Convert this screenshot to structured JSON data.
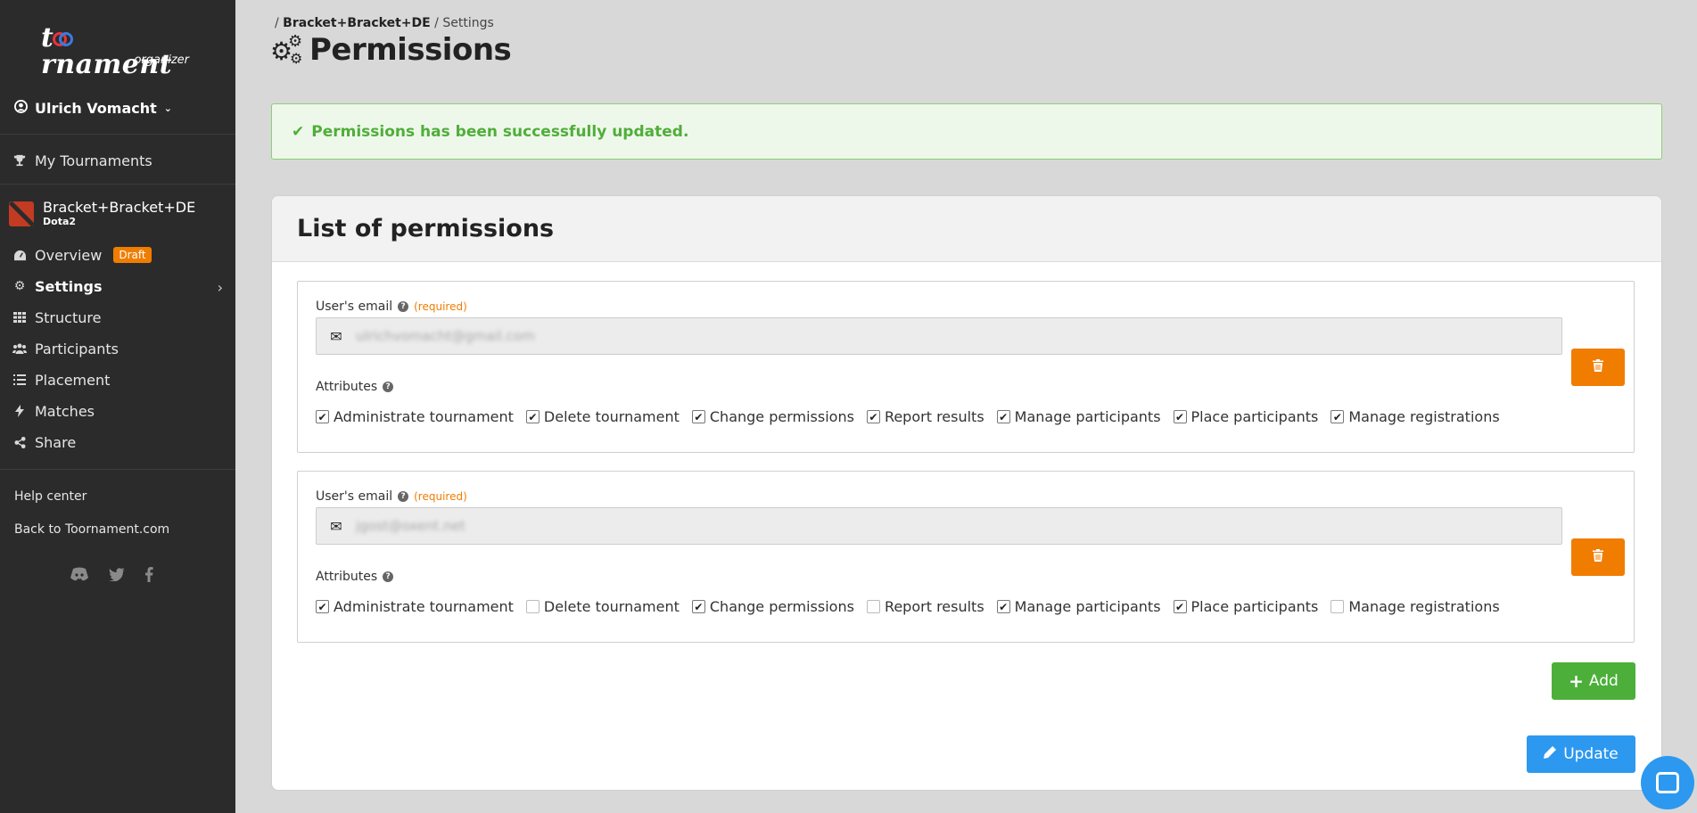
{
  "brand": {
    "logo_word": "tornament",
    "logo_prefix": "t",
    "logo_suffix": "rnament",
    "logo_sub": "organizer"
  },
  "user": {
    "name": "Ulrich Vomacht"
  },
  "sidebar": {
    "my_tournaments": "My Tournaments",
    "tournament": {
      "name": "Bracket+Bracket+DE",
      "game": "Dota2"
    },
    "items": [
      {
        "label": "Overview",
        "icon": "dashboard-icon",
        "badge": "Draft"
      },
      {
        "label": "Settings",
        "icon": "gears-icon"
      },
      {
        "label": "Structure",
        "icon": "grid-icon"
      },
      {
        "label": "Participants",
        "icon": "users-icon"
      },
      {
        "label": "Placement",
        "icon": "list-icon"
      },
      {
        "label": "Matches",
        "icon": "bolt-icon"
      },
      {
        "label": "Share",
        "icon": "share-icon"
      }
    ],
    "help_center": "Help center",
    "back_link": "Back to Toornament.com",
    "socials": [
      "discord-icon",
      "twitter-icon",
      "facebook-icon"
    ]
  },
  "breadcrumb": {
    "sep": "/",
    "tournament": "Bracket+Bracket+DE",
    "current": "Settings"
  },
  "page": {
    "title": "Permissions"
  },
  "alert": {
    "message": "Permissions has been successfully updated."
  },
  "card": {
    "title": "List of permissions",
    "email_label": "User's email",
    "required": "(required)",
    "attributes_label": "Attributes",
    "add_label": "Add",
    "update_label": "Update"
  },
  "attribute_names": [
    "Administrate tournament",
    "Delete tournament",
    "Change permissions",
    "Report results",
    "Manage participants",
    "Place participants",
    "Manage registrations"
  ],
  "permissions": [
    {
      "email": "ulrichvomacht@gmail.com",
      "checked": [
        true,
        true,
        true,
        true,
        true,
        true,
        true
      ]
    },
    {
      "email": "jgost@oxent.net",
      "checked": [
        true,
        false,
        true,
        false,
        true,
        true,
        false
      ]
    }
  ],
  "colors": {
    "sidebar": "#2b2b2b",
    "accent_orange": "#f07d00",
    "success_green": "#4caf3a",
    "primary_blue": "#2c98f0"
  }
}
